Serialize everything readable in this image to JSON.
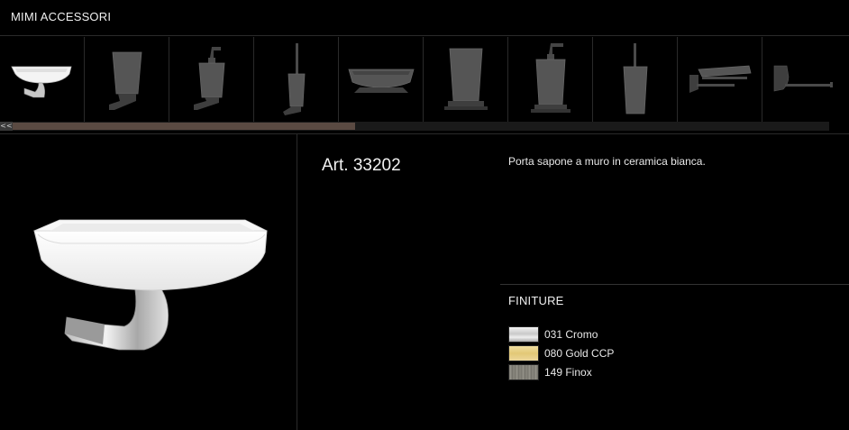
{
  "header": {
    "title": "MIMI ACCESSORI"
  },
  "thumbnails": [
    {
      "icon": "soap-dish-white-icon"
    },
    {
      "icon": "tumbler-holder-icon"
    },
    {
      "icon": "wall-soap-dispenser-icon"
    },
    {
      "icon": "wall-toilet-brush-icon"
    },
    {
      "icon": "countertop-soap-dish-icon"
    },
    {
      "icon": "countertop-tumbler-icon"
    },
    {
      "icon": "countertop-soap-dispenser-icon"
    },
    {
      "icon": "standing-toilet-brush-icon"
    },
    {
      "icon": "paper-holder-with-cover-icon"
    },
    {
      "icon": "paper-holder-icon"
    }
  ],
  "scrollbar": {
    "left_arrow": "<<"
  },
  "product": {
    "art_code": "Art. 33202",
    "description": "Porta sapone a muro in ceramica bianca."
  },
  "finishes": {
    "title": "FINITURE",
    "items": [
      {
        "label": "031 Cromo",
        "color": "#cfcfcf"
      },
      {
        "label": "080 Gold CCP",
        "color": "#e4cb7c"
      },
      {
        "label": "149 Finox",
        "color": "#858379"
      }
    ]
  },
  "colors": {
    "background": "#000000",
    "divider": "#2a2a2a",
    "scroll_thumb": "#5a4a42"
  }
}
